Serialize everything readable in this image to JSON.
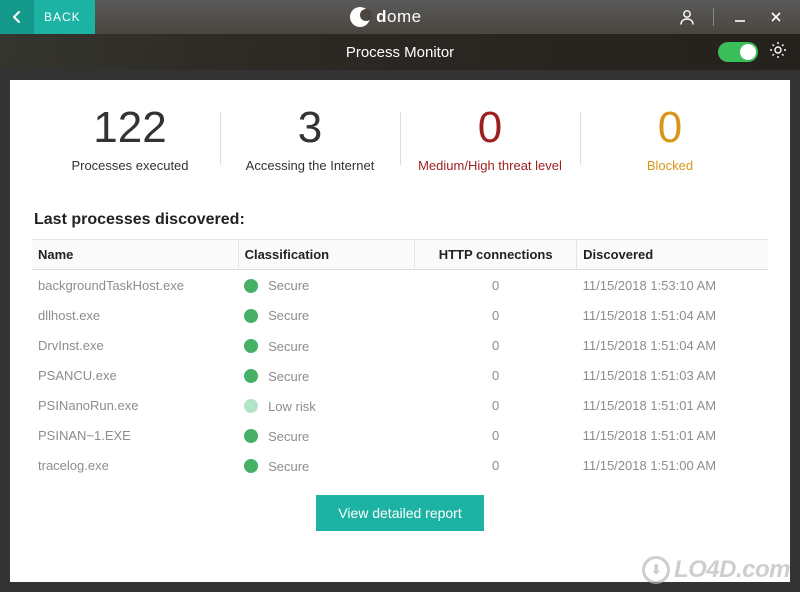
{
  "titlebar": {
    "back_label": "BACK",
    "brand_prefix": "d",
    "brand_rest": "ome"
  },
  "subheader": {
    "title": "Process Monitor"
  },
  "stats": {
    "executed": {
      "value": "122",
      "label": "Processes executed"
    },
    "internet": {
      "value": "3",
      "label": "Accessing the Internet"
    },
    "threat": {
      "value": "0",
      "label": "Medium/High threat level"
    },
    "blocked": {
      "value": "0",
      "label": "Blocked"
    }
  },
  "section_title": "Last processes discovered:",
  "columns": {
    "name": "Name",
    "classification": "Classification",
    "http": "HTTP connections",
    "discovered": "Discovered"
  },
  "rows": [
    {
      "name": "backgroundTaskHost.exe",
      "class": "Secure",
      "dot": "secure",
      "http": "0",
      "discovered": "11/15/2018 1:53:10 AM"
    },
    {
      "name": "dllhost.exe",
      "class": "Secure",
      "dot": "secure",
      "http": "0",
      "discovered": "11/15/2018 1:51:04 AM"
    },
    {
      "name": "DrvInst.exe",
      "class": "Secure",
      "dot": "secure",
      "http": "0",
      "discovered": "11/15/2018 1:51:04 AM"
    },
    {
      "name": "PSANCU.exe",
      "class": "Secure",
      "dot": "secure",
      "http": "0",
      "discovered": "11/15/2018 1:51:03 AM"
    },
    {
      "name": "PSINanoRun.exe",
      "class": "Low risk",
      "dot": "low",
      "http": "0",
      "discovered": "11/15/2018 1:51:01 AM"
    },
    {
      "name": "PSINAN~1.EXE",
      "class": "Secure",
      "dot": "secure",
      "http": "0",
      "discovered": "11/15/2018 1:51:01 AM"
    },
    {
      "name": "tracelog.exe",
      "class": "Secure",
      "dot": "secure",
      "http": "0",
      "discovered": "11/15/2018 1:51:00 AM"
    }
  ],
  "report_button": "View detailed report",
  "watermark": "LO4D.com"
}
